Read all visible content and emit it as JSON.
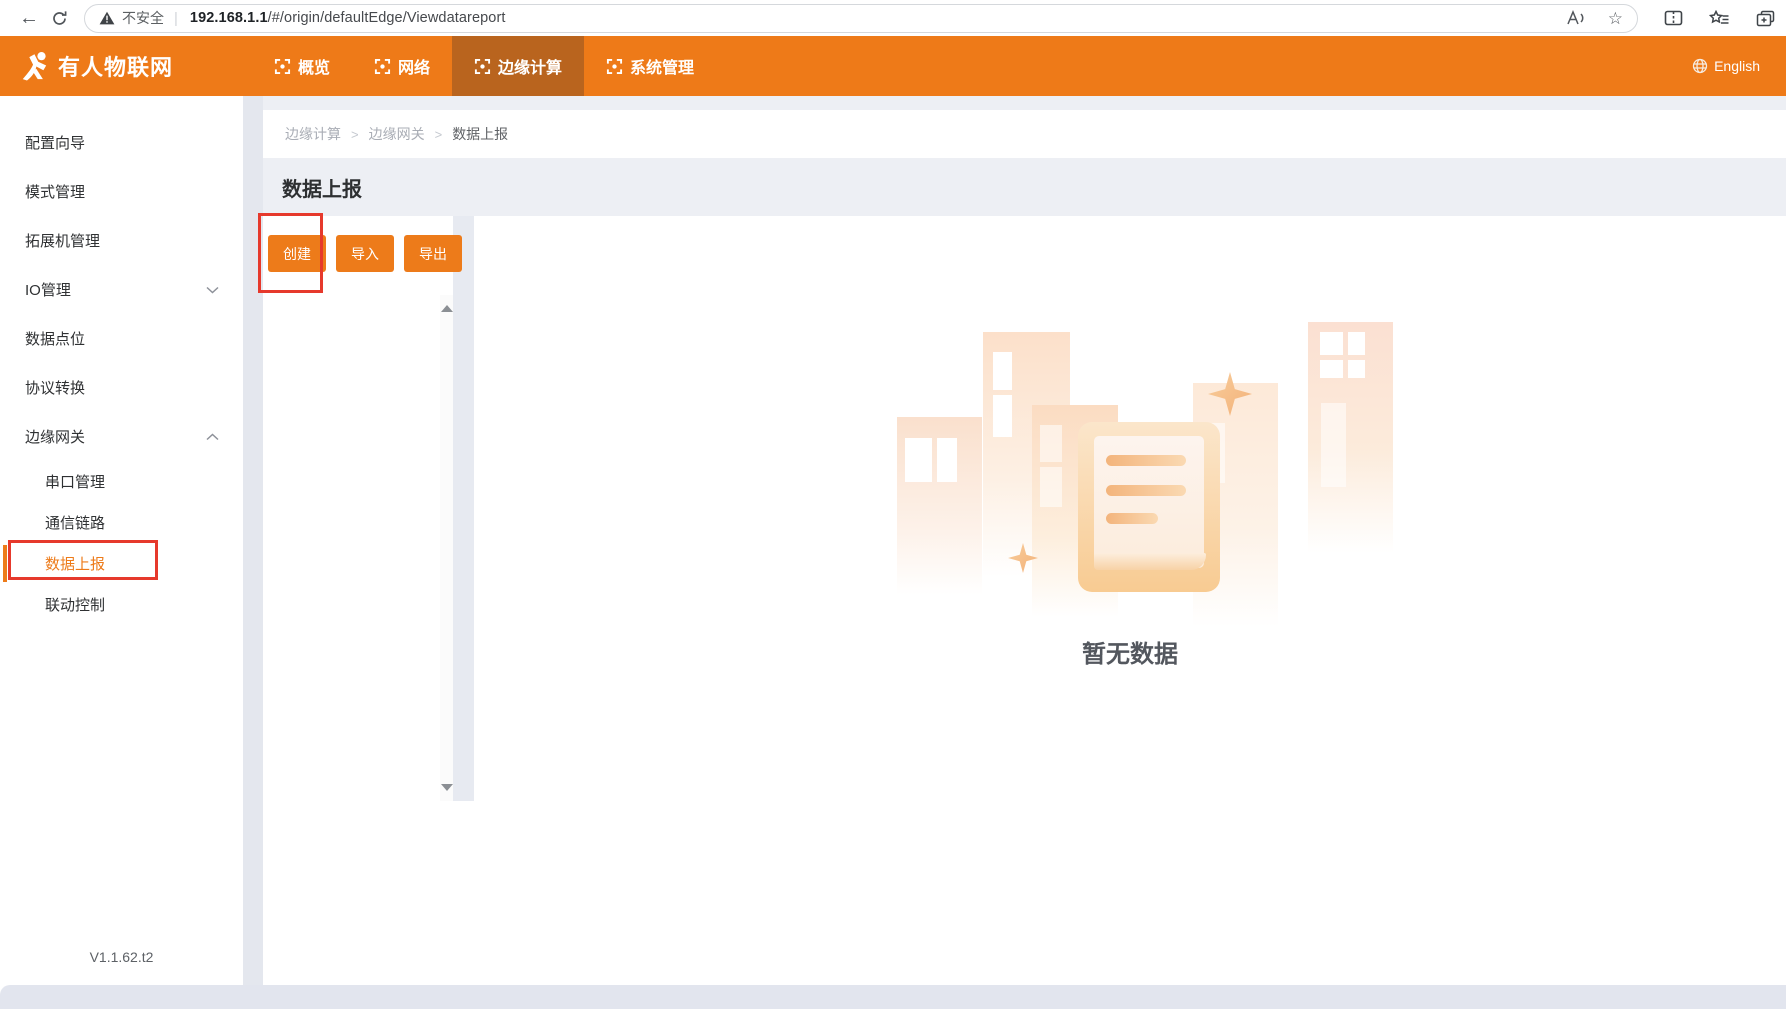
{
  "browser": {
    "security_label": "不安全",
    "url_domain": "192.168.1.1",
    "url_path": "/#/origin/defaultEdge/Viewdatareport",
    "icons": {
      "back": "←",
      "favorite": "☆"
    }
  },
  "navbar": {
    "brand": "有人物联网",
    "tabs": [
      {
        "label": "概览",
        "active": false
      },
      {
        "label": "网络",
        "active": false
      },
      {
        "label": "边缘计算",
        "active": true
      },
      {
        "label": "系统管理",
        "active": false
      }
    ],
    "language": "English"
  },
  "sidebar": {
    "items": [
      {
        "label": "配置向导"
      },
      {
        "label": "模式管理"
      },
      {
        "label": "拓展机管理"
      },
      {
        "label": "IO管理",
        "chevron": "down"
      },
      {
        "label": "数据点位"
      },
      {
        "label": "协议转换"
      },
      {
        "label": "边缘网关",
        "chevron": "up"
      },
      {
        "label": "串口管理",
        "sub": true
      },
      {
        "label": "通信链路",
        "sub": true
      },
      {
        "label": "数据上报",
        "sub": true,
        "active": true
      },
      {
        "label": "联动控制",
        "sub": true
      }
    ],
    "version": "V1.1.62.t2"
  },
  "breadcrumb": {
    "items": [
      "边缘计算",
      "边缘网关",
      "数据上报"
    ]
  },
  "page": {
    "title": "数据上报"
  },
  "toolbar": {
    "create": "创建",
    "import": "导入",
    "export": "导出"
  },
  "empty": {
    "text": "暂无数据"
  },
  "colors": {
    "brand_orange": "#ee7a18",
    "active_tab": "#b9641e",
    "button_orange": "#ed7b1a",
    "annotation_red": "#e6392c"
  }
}
